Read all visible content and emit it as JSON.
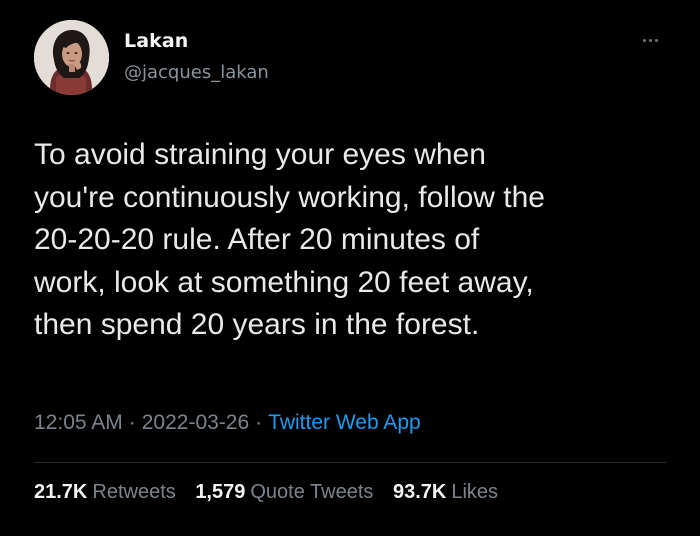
{
  "author": {
    "name": "Lakan",
    "handle": "@jacques_lakan"
  },
  "tweet": {
    "lines": [
      "To avoid straining your eyes when",
      "you're continuously working, follow the",
      "20-20-20 rule. After 20 minutes of",
      "work, look at something 20 feet away,",
      "then spend 20 years in the forest."
    ],
    "time": "12:05 AM",
    "date": "2022-03-26",
    "separator": "·",
    "source": "Twitter Web App"
  },
  "stats": {
    "retweets_count": "21.7K",
    "retweets_label": "Retweets",
    "quotes_count": "1,579",
    "quotes_label": "Quote Tweets",
    "likes_count": "93.7K",
    "likes_label": "Likes"
  },
  "icons": {
    "more": "more-options-icon",
    "avatar": "profile-avatar"
  },
  "colors": {
    "background": "#000000",
    "text": "#e7e9ea",
    "muted": "#7b848c",
    "link": "#1d9bf0"
  }
}
